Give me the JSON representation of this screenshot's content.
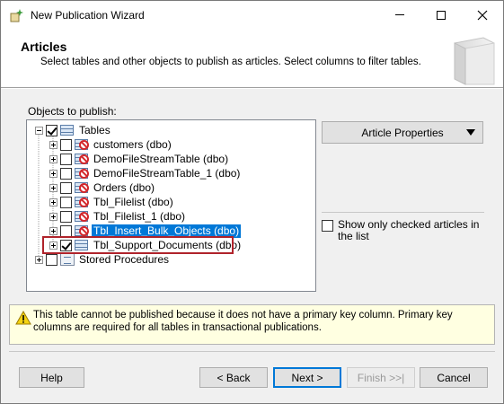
{
  "window": {
    "title": "New Publication Wizard",
    "icon": "wizard-icon"
  },
  "header": {
    "title": "Articles",
    "description": "Select tables and other objects to publish as articles. Select columns to filter tables."
  },
  "objects_label": "Objects to publish:",
  "tree": {
    "root": {
      "label": "Tables",
      "checked": true,
      "expanded": true
    },
    "items": [
      {
        "label": "customers (dbo)",
        "checked": false,
        "publishable": false
      },
      {
        "label": "DemoFileStreamTable (dbo)",
        "checked": false,
        "publishable": false
      },
      {
        "label": "DemoFileStreamTable_1 (dbo)",
        "checked": false,
        "publishable": false
      },
      {
        "label": "Orders (dbo)",
        "checked": false,
        "publishable": false
      },
      {
        "label": "Tbl_Filelist (dbo)",
        "checked": false,
        "publishable": false
      },
      {
        "label": "Tbl_Filelist_1 (dbo)",
        "checked": false,
        "publishable": false
      },
      {
        "label": "Tbl_Insert_Bulk_Objects (dbo)",
        "checked": false,
        "publishable": false,
        "selected": true
      },
      {
        "label": "Tbl_Support_Documents (dbo)",
        "checked": true,
        "publishable": true,
        "highlighted": true
      }
    ],
    "stored_procedures": {
      "label": "Stored Procedures",
      "checked": false
    }
  },
  "article_properties_label": "Article Properties",
  "show_only_checked": {
    "label": "Show only checked articles in the list",
    "checked": false
  },
  "warning": {
    "text": "This table cannot be published because it does not have a primary key column. Primary key columns are required for all tables in transactional publications."
  },
  "buttons": {
    "help": "Help",
    "back": "< Back",
    "next": "Next >",
    "finish": "Finish >>|",
    "cancel": "Cancel"
  },
  "colors": {
    "selection": "#0078d7",
    "highlight_border": "#b0232b",
    "warning_bg": "#ffffe1"
  }
}
